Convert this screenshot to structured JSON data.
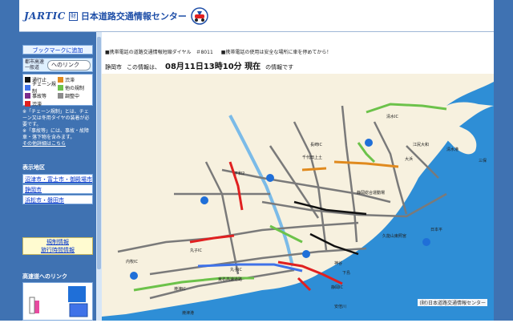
{
  "header": {
    "logo_jartic": "JARTIC",
    "logo_foundation": "財",
    "logo_name": "日本道路交通情報センター"
  },
  "sidebar": {
    "bookmark": "ブックマークに追加",
    "hw_link_label": "都市高速一般道",
    "hw_link_select": "へのリンク",
    "legend": [
      {
        "label": "通行止",
        "color": "#111111"
      },
      {
        "label": "渋滞",
        "color": "#e08a1e"
      },
      {
        "label": "チェーン規制",
        "color": "#3f72e8"
      },
      {
        "label": "他の規制",
        "color": "#6cc24a"
      },
      {
        "label": "事故等",
        "color": "#7a2b8c"
      },
      {
        "label": "調整中",
        "color": "#8c8c8c"
      },
      {
        "label": "渋滞",
        "color": "#e02020"
      }
    ],
    "notes": [
      "※「チェーン規制」とは、チェーン又は冬用タイヤの装着が必要です。",
      "※「事故等」には、事故・故障車・落下物を含みます。",
      "その他詳細はこちら"
    ],
    "region_title": "表示地区",
    "regions": [
      "沼津市・富士市・御殿場市",
      "静岡市",
      "浜松市・磐田市"
    ],
    "info_links": [
      "規制情報",
      "旅行時間情報"
    ],
    "hw_title": "高速道へのリンク"
  },
  "main": {
    "notice_left": "■携帯電話の道路交通情報短縮ダイヤル　＃8011",
    "notice_right": "■携帯電話の使用は安全な場所に車を停めてから！",
    "city": "静岡市",
    "info_pre": "この情報は、",
    "info_time": "08月11日13時10分 現在",
    "info_post": "の情報です",
    "copyright": "(財)日本道路交通情報センター",
    "map_labels": {
      "shimizu_ic": "清水IC",
      "nagasaki_ic": "長崎IC",
      "chiyoshi": "千代田上土",
      "ejiri": "江尻大和",
      "ohama": "大浜",
      "shimizu_port": "清水港",
      "miho": "三保",
      "hiraoka": "平和2",
      "sports": "静岡総合運動場",
      "kunouzan": "久能山東照宮",
      "nihondaira": "日本平",
      "uchimaki": "内牧IC",
      "marukoD": "丸子IC",
      "marukoN": "丸子IC",
      "yaizu_ic": "焼津IC",
      "shizuoka_ic": "静岡IC",
      "tomei": "東名高速道路",
      "abegawa": "安倍川",
      "yaizu_port": "焼津港",
      "shimoshima": "下島",
      "kamiya": "神谷"
    }
  }
}
